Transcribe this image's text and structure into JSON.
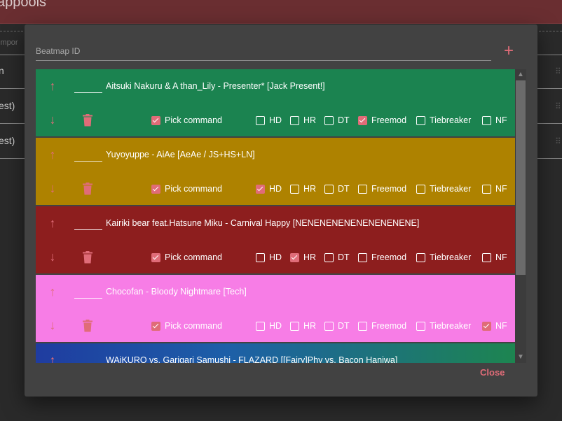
{
  "background": {
    "header_title": "appools",
    "column_label": "impor",
    "rows": [
      {
        "label": "n"
      },
      {
        "label": "est)"
      },
      {
        "label": "est)"
      }
    ]
  },
  "dialog": {
    "beatmap_id": {
      "value": "",
      "placeholder": "Beatmap ID"
    },
    "add_icon": "plus-icon",
    "close_label": "Close",
    "colors": {
      "accent": "#e06c78",
      "dialog_bg": "#424242"
    },
    "mods": [
      "Pick command",
      "HD",
      "HR",
      "DT",
      "Freemod",
      "Tiebreaker",
      "NF"
    ],
    "beatmaps": [
      {
        "title": "Aitsuki Nakuru & A than_Lily - Presenter* [Jack Present!]",
        "position": "",
        "color": "#1b8350",
        "checked": [
          true,
          false,
          false,
          false,
          true,
          false,
          false
        ]
      },
      {
        "title": "Yuyoyuppe - AiAe [AeAe / JS+HS+LN]",
        "position": "",
        "color": "#ae8200",
        "checked": [
          true,
          true,
          false,
          false,
          false,
          false,
          false
        ]
      },
      {
        "title": "Kairiki bear feat.Hatsune Miku - Carnival Happy [NENENENENENENENENENE]",
        "position": "",
        "color": "#8d1e1e",
        "checked": [
          true,
          false,
          true,
          false,
          false,
          false,
          false
        ]
      },
      {
        "title": "Chocofan - Bloody Nightmare [Tech]",
        "position": "",
        "color": "#f77de6",
        "checked": [
          true,
          false,
          false,
          false,
          false,
          false,
          true
        ]
      },
      {
        "title": "WAiKURO vs. Garigari Samushi - FLAZARD [[Fairy]Phy vs. Bacon Haniwa]",
        "position": "",
        "color": "linear-gradient(90deg,#1f3ca0,#1d5fa8 40%,#1d8550)",
        "checked": [
          false,
          false,
          false,
          false,
          false,
          false,
          false
        ]
      }
    ]
  }
}
